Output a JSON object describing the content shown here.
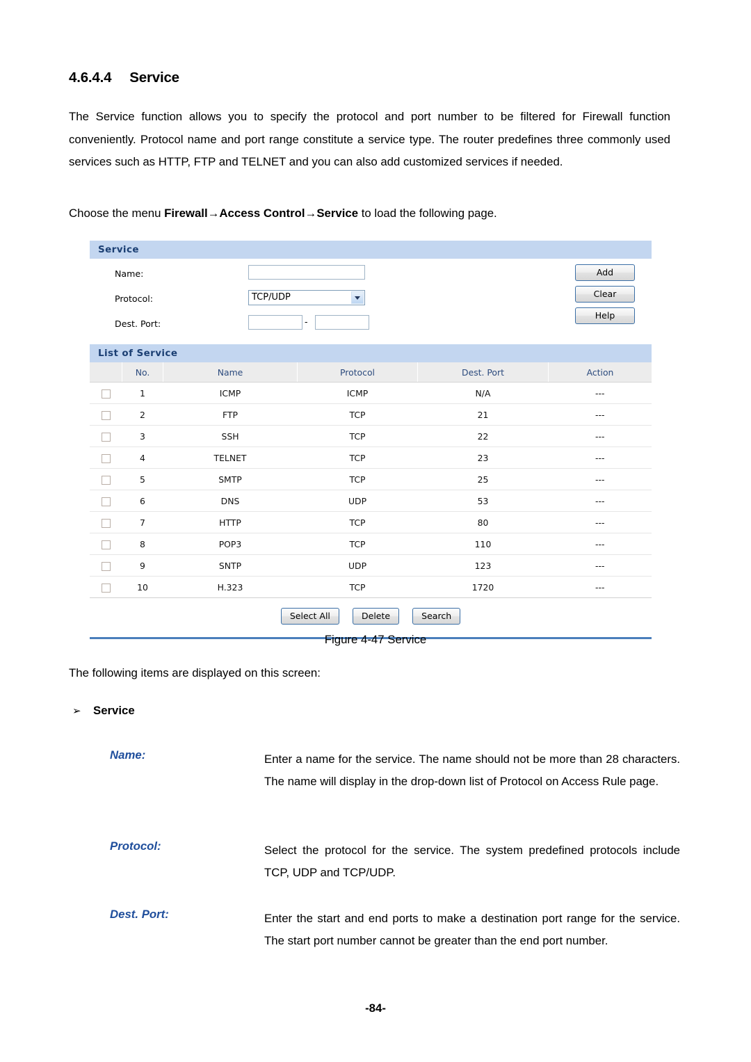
{
  "document": {
    "section_number": "4.6.4.4",
    "section_title": "Service",
    "intro_paragraph": "The Service function allows you to specify the protocol and port number to be filtered for Firewall function conveniently. Protocol name and port range constitute a service type. The router predefines three commonly used services such as HTTP, FTP and TELNET and you can also add customized services if needed.",
    "choose_prefix": "Choose the menu ",
    "choose_menu_1": "Firewall",
    "choose_arrow_1": "→",
    "choose_menu_2": "Access Control",
    "choose_arrow_2": "→",
    "choose_menu_3": "Service",
    "choose_suffix": " to load the following page.",
    "figure_caption": "Figure 4-47 Service",
    "following_items": "The following items are displayed on this screen:",
    "bullet_arrow": "➢",
    "bullet_label": "Service",
    "page_number": "-84-"
  },
  "definitions": [
    {
      "term": "Name:",
      "description": "Enter a name for the service. The name should not be more than 28 characters. The name will display in the drop-down list of Protocol on Access Rule page."
    },
    {
      "term": "Protocol:",
      "description": "Select the protocol for the service. The system predefined protocols include TCP, UDP and TCP/UDP."
    },
    {
      "term": "Dest. Port:",
      "description": "Enter the start and end ports to make a destination port range for the service. The start port number cannot be greater than the end port number."
    }
  ],
  "ui": {
    "service_panel": {
      "title": "Service",
      "fields": {
        "name_label": "Name:",
        "name_value": "",
        "name_placeholder": "",
        "protocol_label": "Protocol:",
        "protocol_value": "TCP/UDP",
        "protocol_options": [
          "TCP",
          "UDP",
          "TCP/UDP"
        ],
        "dest_port_label": "Dest. Port:",
        "dest_port_start": "",
        "dest_port_end": "",
        "dest_port_separator": "-"
      },
      "buttons": {
        "add": "Add",
        "clear": "Clear",
        "help": "Help"
      }
    },
    "list_panel": {
      "title": "List of Service",
      "columns": [
        "",
        "No.",
        "Name",
        "Protocol",
        "Dest. Port",
        "Action"
      ],
      "rows": [
        {
          "no": "1",
          "name": "ICMP",
          "protocol": "ICMP",
          "dest_port": "N/A",
          "action": "---"
        },
        {
          "no": "2",
          "name": "FTP",
          "protocol": "TCP",
          "dest_port": "21",
          "action": "---"
        },
        {
          "no": "3",
          "name": "SSH",
          "protocol": "TCP",
          "dest_port": "22",
          "action": "---"
        },
        {
          "no": "4",
          "name": "TELNET",
          "protocol": "TCP",
          "dest_port": "23",
          "action": "---"
        },
        {
          "no": "5",
          "name": "SMTP",
          "protocol": "TCP",
          "dest_port": "25",
          "action": "---"
        },
        {
          "no": "6",
          "name": "DNS",
          "protocol": "UDP",
          "dest_port": "53",
          "action": "---"
        },
        {
          "no": "7",
          "name": "HTTP",
          "protocol": "TCP",
          "dest_port": "80",
          "action": "---"
        },
        {
          "no": "8",
          "name": "POP3",
          "protocol": "TCP",
          "dest_port": "110",
          "action": "---"
        },
        {
          "no": "9",
          "name": "SNTP",
          "protocol": "UDP",
          "dest_port": "123",
          "action": "---"
        },
        {
          "no": "10",
          "name": "H.323",
          "protocol": "TCP",
          "dest_port": "1720",
          "action": "---"
        }
      ],
      "actions": {
        "select_all": "Select All",
        "delete": "Delete",
        "search": "Search"
      }
    },
    "colors": {
      "panel_header_bg": "#c3d6f0",
      "panel_header_text": "#1b3f73",
      "table_header_bg": "#ececec",
      "table_header_text": "#2b4a7d",
      "rule": "#4a7ebb",
      "term_color": "#1f4e9c",
      "button_border": "#3a6ea5"
    }
  }
}
